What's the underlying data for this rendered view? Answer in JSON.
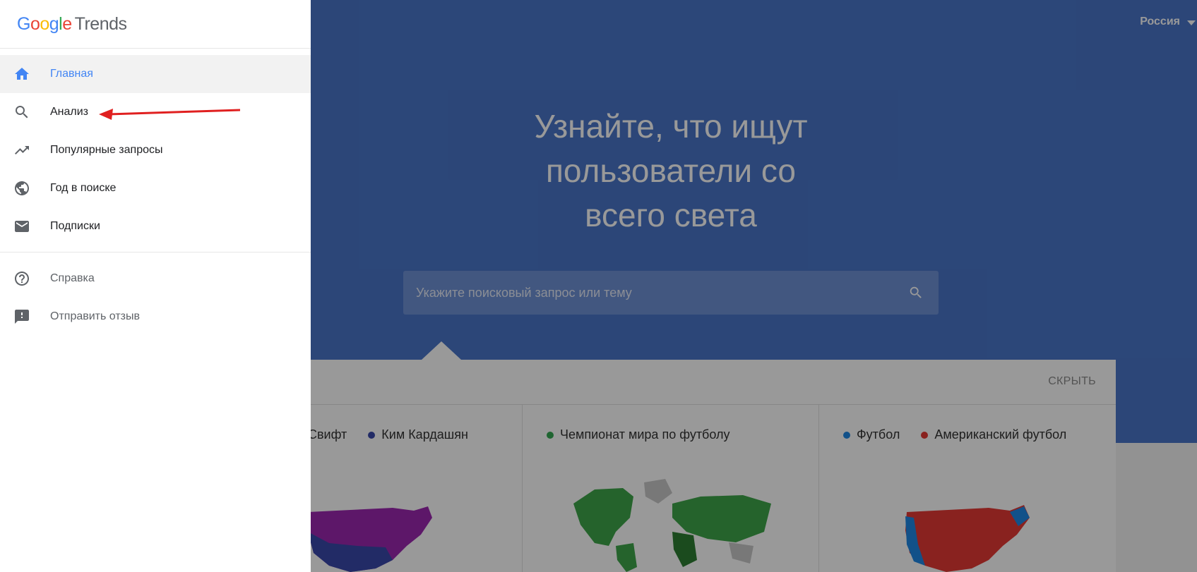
{
  "app": {
    "logo": {
      "google": [
        "G",
        "o",
        "o",
        "g",
        "l",
        "e"
      ],
      "product": "Trends"
    }
  },
  "header": {
    "region": "Россия"
  },
  "hero": {
    "headline": [
      "Узнайте, что ищут",
      "пользователи со",
      "всего света"
    ],
    "search_placeholder": "Укажите поисковый запрос или тему"
  },
  "examples": {
    "hide_label": "СКРЫТЬ",
    "columns": [
      {
        "legend": [
          {
            "label": "Свифт",
            "color": "#9c27b0"
          },
          {
            "label": "Ким Кардашян",
            "color": "#3949ab"
          }
        ]
      },
      {
        "legend": [
          {
            "label": "Чемпионат мира по футболу",
            "color": "#34a853"
          }
        ]
      },
      {
        "legend": [
          {
            "label": "Футбол",
            "color": "#1e88e5"
          },
          {
            "label": "Американский футбол",
            "color": "#e53935"
          }
        ]
      }
    ]
  },
  "drawer": {
    "primary": [
      {
        "label": "Главная",
        "icon": "home-icon",
        "active": true
      },
      {
        "label": "Анализ",
        "icon": "search-icon",
        "active": false
      },
      {
        "label": "Популярные запросы",
        "icon": "trending-up-icon",
        "active": false
      },
      {
        "label": "Год в поиске",
        "icon": "globe-icon",
        "active": false
      },
      {
        "label": "Подписки",
        "icon": "mail-icon",
        "active": false
      }
    ],
    "secondary": [
      {
        "label": "Справка",
        "icon": "help-icon"
      },
      {
        "label": "Отправить отзыв",
        "icon": "feedback-icon"
      }
    ]
  },
  "colors": {
    "hero_bg": "#4a76c9",
    "accent": "#4285f4",
    "annotation_arrow": "#e02020"
  }
}
